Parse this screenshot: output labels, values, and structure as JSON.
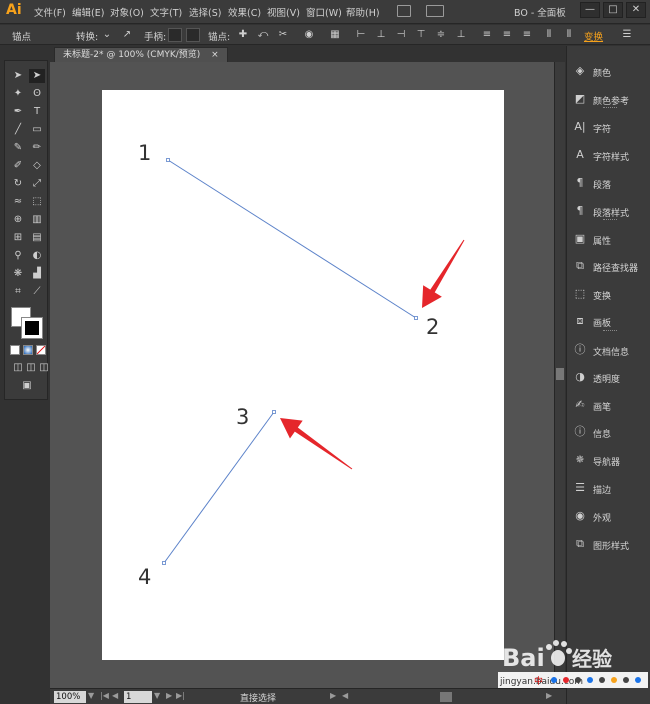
{
  "app": {
    "logo": "Ai"
  },
  "menubar": {
    "items": [
      "文件(F)",
      "编辑(E)",
      "对象(O)",
      "文字(T)",
      "选择(S)",
      "效果(C)",
      "视图(V)",
      "窗口(W)",
      "帮助(H)"
    ],
    "workspace": "BO - 全面板",
    "window_controls": [
      "—",
      "□",
      "✕"
    ]
  },
  "controlbar": {
    "anchor_label": "锚点",
    "convert_label": "转换:",
    "handles_label": "手柄:",
    "anchors_label": "锚点:",
    "transform_link": "变换"
  },
  "document": {
    "tab_title": "未标题-2* @ 100% (CMYK/预览)",
    "tab_close": "×"
  },
  "artwork": {
    "labels": [
      "1",
      "2",
      "3",
      "4"
    ],
    "line_color": "#5b82c9",
    "arrow_color": "#e5262b"
  },
  "statusbar": {
    "zoom": "100%",
    "artboard_number": "1",
    "status_text": "直接选择"
  },
  "panels": {
    "items": [
      {
        "label": "颜色",
        "icon": "color-icon"
      },
      {
        "label": "颜色参考",
        "icon": "color-guide-icon"
      },
      {
        "label": "字符",
        "icon": "character-icon"
      },
      {
        "label": "字符样式",
        "icon": "character-style-icon"
      },
      {
        "label": "段落",
        "icon": "paragraph-icon"
      },
      {
        "label": "段落样式",
        "icon": "paragraph-style-icon"
      },
      {
        "label": "属性",
        "icon": "attributes-icon"
      },
      {
        "label": "路径查找器",
        "icon": "pathfinder-icon"
      },
      {
        "label": "变换",
        "icon": "transform-icon"
      },
      {
        "label": "画板",
        "icon": "artboards-icon"
      },
      {
        "label": "文档信息",
        "icon": "document-info-icon"
      },
      {
        "label": "透明度",
        "icon": "transparency-icon"
      },
      {
        "label": "画笔",
        "icon": "brushes-icon"
      },
      {
        "label": "信息",
        "icon": "info-icon"
      },
      {
        "label": "导航器",
        "icon": "navigator-icon"
      },
      {
        "label": "描边",
        "icon": "stroke-icon"
      },
      {
        "label": "外观",
        "icon": "appearance-icon"
      },
      {
        "label": "图形样式",
        "icon": "graphic-styles-icon"
      }
    ]
  },
  "watermark": {
    "brand": "Bai",
    "brand2": "经验",
    "url": "jingyan.baidu.com",
    "tray": "中"
  }
}
